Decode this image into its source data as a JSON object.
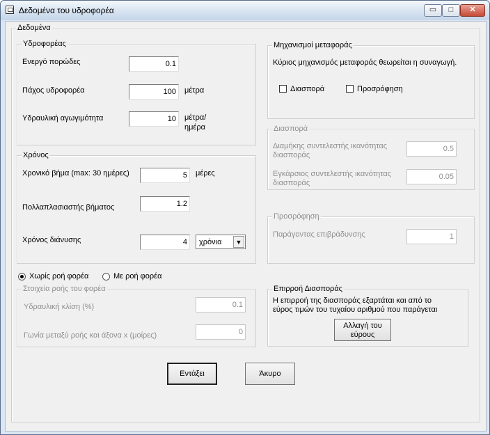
{
  "window": {
    "title": "Δεδομένα του υδροφορέα",
    "minimize_glyph": "▭",
    "maximize_glyph": "□",
    "close_glyph": "✕"
  },
  "main_group": {
    "title": "Δεδομένα"
  },
  "aquifer": {
    "title": "Υδροφορέας",
    "porosity": {
      "label": "Ενεργό πορώδες",
      "value": "0.1"
    },
    "thickness": {
      "label": "Πάχος υδροφορέα",
      "value": "100",
      "unit": "μέτρα"
    },
    "conductivity": {
      "label": "Υδραυλική αγωγιμότητα",
      "value": "10",
      "unit_line1": "μέτρα/",
      "unit_line2": "ημέρα"
    }
  },
  "time": {
    "title": "Χρόνος",
    "step": {
      "label": "Χρονικό βήμα  (max: 30 ημέρες)",
      "value": "5",
      "unit": "μέρες"
    },
    "multiplier": {
      "label": "Πολλαπλασιαστής βήματος",
      "value": "1.2"
    },
    "duration": {
      "label": "Χρόνος διάνυσης",
      "value": "4",
      "unit_selected": "χρόνια"
    }
  },
  "flow_mode": {
    "option_no_flow": "Χωρίς ροή φορέα",
    "option_with_flow": "Με ροή φορέα",
    "selected": "no_flow"
  },
  "flow": {
    "title": "Στοιχεία ροής του φορέα",
    "gradient": {
      "label": "Υδραυλική κλίση (%)",
      "value": "0.1"
    },
    "angle": {
      "label": "Γωνία μεταξύ ροής και άξονα x (μοίρες)",
      "value": "0"
    }
  },
  "mechanisms": {
    "title": "Μηχανισμοί μεταφοράς",
    "description": "Κύριος μηχανισμός μεταφοράς θεωρείται η συναγωγή.",
    "dispersion_checkbox": "Διασπορά",
    "sorption_checkbox": "Προσρόφηση",
    "dispersion_checked": false,
    "sorption_checked": false
  },
  "dispersion": {
    "title": "Διασπορά",
    "longitudinal": {
      "label_line1": "Διαμήκης συντελεστής ικανότητας",
      "label_line2": "διασποράς",
      "value": "0.5"
    },
    "transverse": {
      "label_line1": "Εγκάρσιος συντελεστής ικανότητας",
      "label_line2": "διασποράς",
      "value": "0.05"
    }
  },
  "sorption": {
    "title": "Προσρόφηση",
    "retardation": {
      "label": "Παράγοντας επιβράδυνσης",
      "value": "1"
    }
  },
  "dispersion_influence": {
    "title": "Επιρροή Διασποράς",
    "text_line1": "Η επιρροή της διασποράς εξαρτάται και από το",
    "text_line2": "εύρος τιμών του τυχαίου αριθμού που παράγεται",
    "button_line1": "Αλλαγή του",
    "button_line2": "εύρους"
  },
  "buttons": {
    "ok": "Εντάξει",
    "cancel": "Άκυρο"
  },
  "colors": {
    "titlebar": "#d7e3f1",
    "client": "#f0f0f0",
    "disabled_text": "#8f8f8f",
    "close_button": "#c74a36"
  }
}
